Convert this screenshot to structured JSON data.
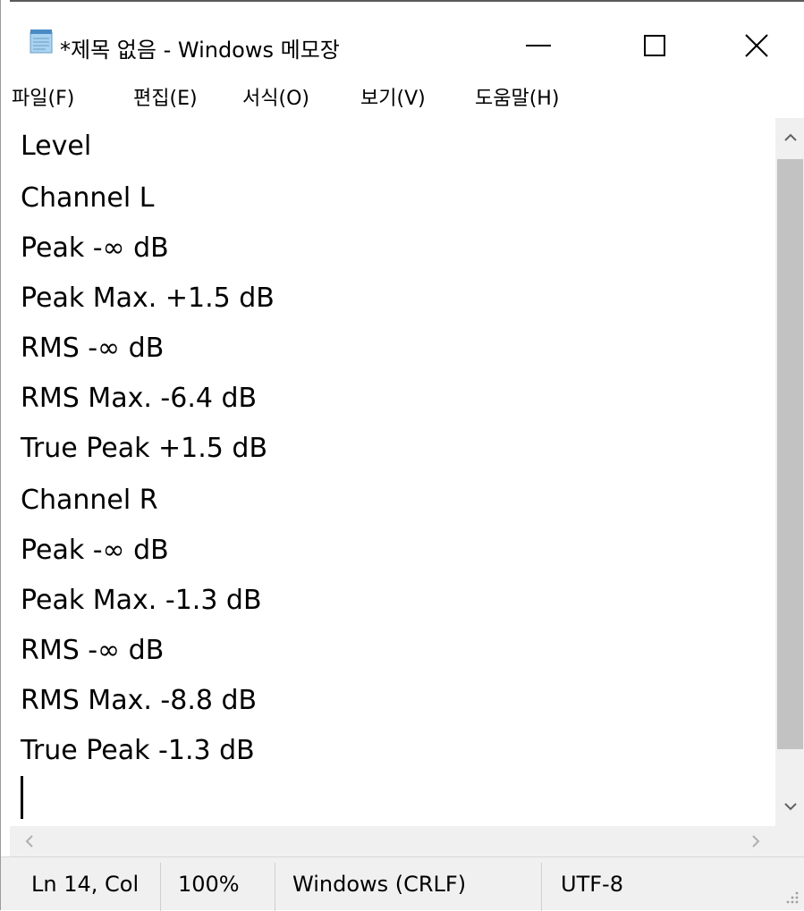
{
  "window": {
    "title": "*제목 없음 - Windows 메모장",
    "icon": "notepad-icon",
    "controls": {
      "minimize": "minimize-icon",
      "maximize": "maximize-icon",
      "close": "close-icon"
    }
  },
  "menu": {
    "items": [
      {
        "label": "파일(F)"
      },
      {
        "label": "편집(E)"
      },
      {
        "label": "서식(O)"
      },
      {
        "label": "보기(V)"
      },
      {
        "label": "도움말(H)"
      }
    ]
  },
  "editor": {
    "lines": [
      "Level",
      "Channel L",
      "Peak -∞ dB",
      "Peak Max. +1.5 dB",
      "RMS -∞ dB",
      "RMS Max. -6.4 dB",
      "True Peak +1.5 dB",
      "Channel R",
      "Peak -∞ dB",
      "Peak Max. -1.3 dB",
      "RMS -∞ dB",
      "RMS Max. -8.8 dB",
      "True Peak -1.3 dB"
    ]
  },
  "status": {
    "position": "Ln 14, Col",
    "zoom": "100%",
    "line_ending": "Windows (CRLF)",
    "encoding": "UTF-8"
  },
  "colors": {
    "scroll_thumb": "#c2c2c2",
    "chrome_bg": "#f0f0f0"
  }
}
